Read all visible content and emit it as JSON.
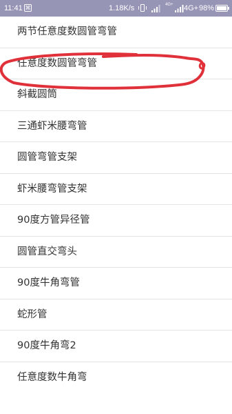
{
  "status_bar": {
    "time": "11:41",
    "notification_icon": "app-notification-icon",
    "net_speed": "1.18K/s",
    "sim1_label": "4G+",
    "net_type": "4G+",
    "battery_percent": "98%",
    "battery_level": 0.98,
    "background_color": "#9695b6"
  },
  "list": {
    "items": [
      {
        "label": "两节任意度数圆管弯管"
      },
      {
        "label": "任意度数圆管弯管"
      },
      {
        "label": "斜截圆筒"
      },
      {
        "label": "三通虾米腰弯管"
      },
      {
        "label": "圆管弯管支架"
      },
      {
        "label": "虾米腰弯管支架"
      },
      {
        "label": "90度方管异径管"
      },
      {
        "label": "圆管直交弯头"
      },
      {
        "label": "90度牛角弯管"
      },
      {
        "label": "蛇形管"
      },
      {
        "label": "90度牛角弯2"
      },
      {
        "label": "任意度数牛角弯"
      }
    ],
    "highlighted_index": 1
  },
  "colors": {
    "text": "#333333",
    "divider": "#e4e4e4",
    "annotation_stroke": "#e0303a"
  }
}
